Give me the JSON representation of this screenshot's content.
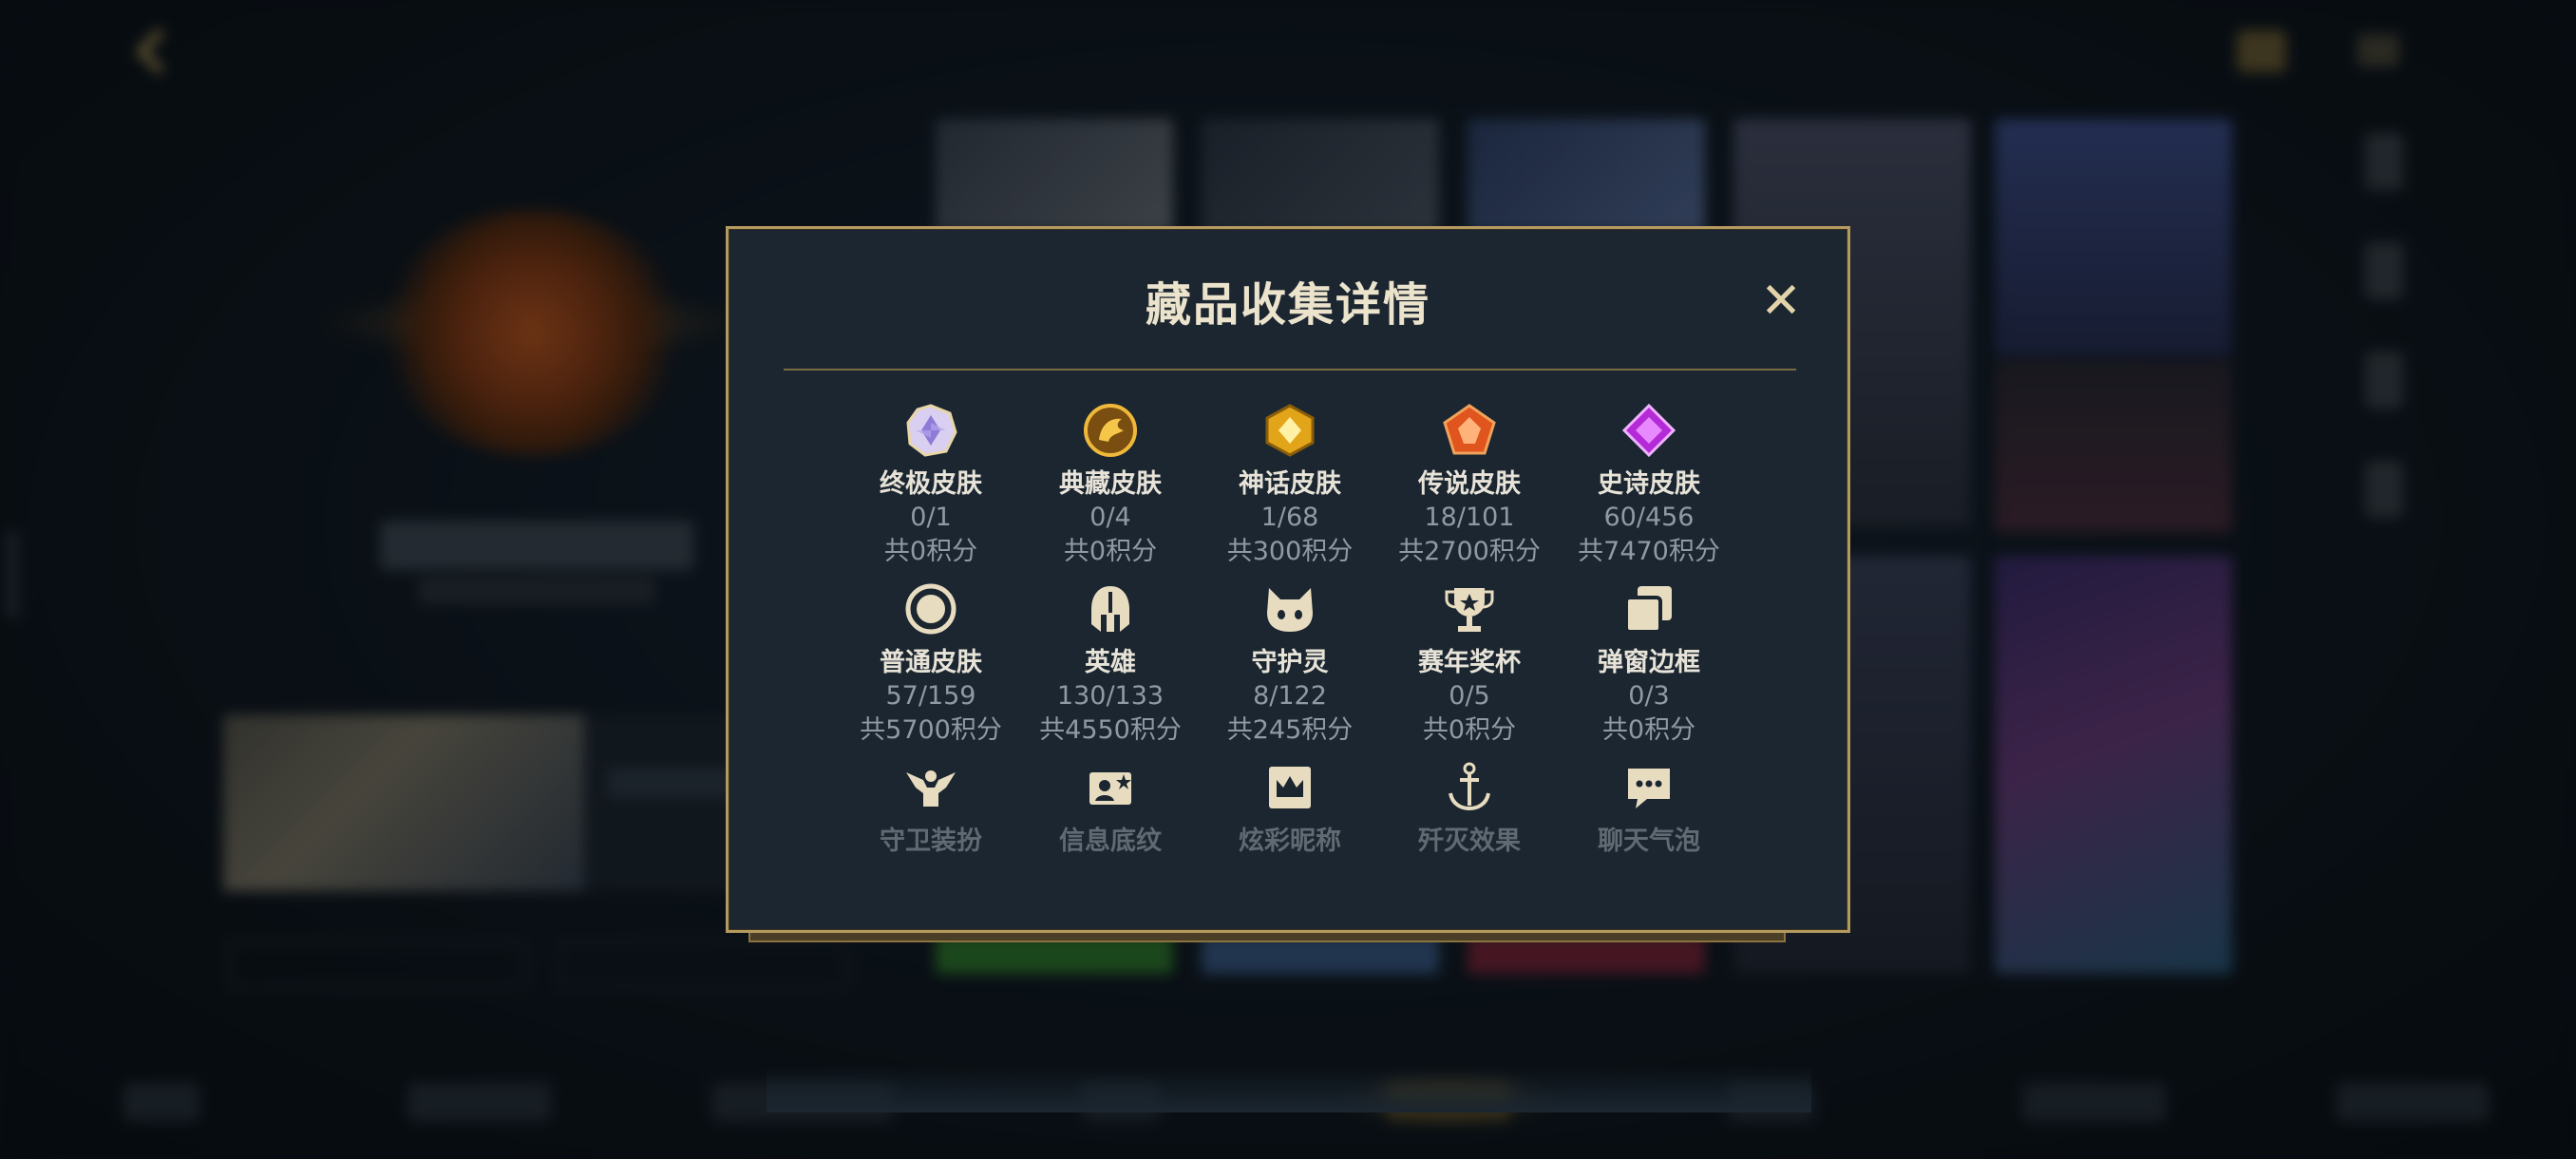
{
  "modal": {
    "title": "藏品收集详情",
    "close_glyph": "✕"
  },
  "collections": [
    {
      "icon": "ultimate-skin-icon",
      "label": "终极皮肤",
      "count": "0/1",
      "points": "共0积分"
    },
    {
      "icon": "prestige-skin-icon",
      "label": "典藏皮肤",
      "count": "0/4",
      "points": "共0积分"
    },
    {
      "icon": "mythic-skin-icon",
      "label": "神话皮肤",
      "count": "1/68",
      "points": "共300积分"
    },
    {
      "icon": "legendary-skin-icon",
      "label": "传说皮肤",
      "count": "18/101",
      "points": "共2700积分"
    },
    {
      "icon": "epic-skin-icon",
      "label": "史诗皮肤",
      "count": "60/456",
      "points": "共7470积分"
    },
    {
      "icon": "standard-skin-icon",
      "label": "普通皮肤",
      "count": "57/159",
      "points": "共5700积分"
    },
    {
      "icon": "champion-helmet-icon",
      "label": "英雄",
      "count": "130/133",
      "points": "共4550积分"
    },
    {
      "icon": "guardian-pet-icon",
      "label": "守护灵",
      "count": "8/122",
      "points": "共245积分"
    },
    {
      "icon": "trophy-icon",
      "label": "赛年奖杯",
      "count": "0/5",
      "points": "共0积分"
    },
    {
      "icon": "popup-frame-icon",
      "label": "弹窗边框",
      "count": "0/3",
      "points": "共0积分"
    },
    {
      "icon": "guardian-outfit-icon",
      "label": "守卫装扮"
    },
    {
      "icon": "info-card-icon",
      "label": "信息底纹"
    },
    {
      "icon": "crown-nickname-icon",
      "label": "炫彩昵称"
    },
    {
      "icon": "elimination-effect-icon",
      "label": "歼灭效果"
    },
    {
      "icon": "chat-bubble-icon",
      "label": "聊天气泡"
    }
  ],
  "colors": {
    "gold_border": "#b49a5f",
    "panel_bg": "#1b2630",
    "title_text": "#ece3cc",
    "label_text": "#e7e3d8",
    "muted_text": "#8f9aa3"
  }
}
